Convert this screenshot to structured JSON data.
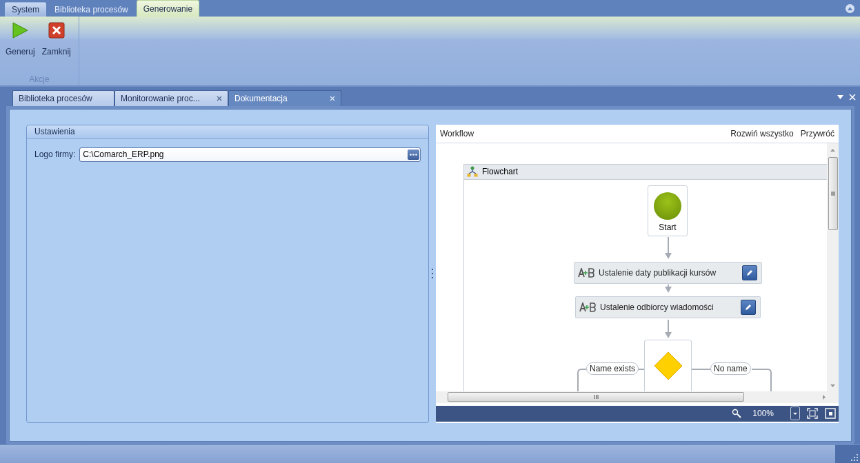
{
  "ribbon_tabs": [
    {
      "label": "System",
      "kind": "app",
      "selected": false
    },
    {
      "label": "Biblioteka procesów",
      "kind": "tab",
      "selected": false
    },
    {
      "label": "Generowanie",
      "kind": "tab",
      "selected": true
    }
  ],
  "ribbon_group": {
    "label": "Akcje",
    "buttons": [
      {
        "label": "Generuj",
        "kind": "play"
      },
      {
        "label": "Zamknij",
        "kind": "close"
      }
    ]
  },
  "document_tabs": [
    {
      "label": "Biblioteka procesów",
      "closable": false,
      "selected": false
    },
    {
      "label": "Monitorowanie proc...",
      "closable": true,
      "selected": false
    },
    {
      "label": "Dokumentacja",
      "closable": true,
      "selected": true
    }
  ],
  "settings": {
    "title": "Ustawienia",
    "field_label": "Logo firmy:",
    "field_value": "C:\\Comarch_ERP.png"
  },
  "designer": {
    "title": "Workflow",
    "actions": [
      "Rozwiń wszystko",
      "Przywróć"
    ],
    "flowchart_title": "Flowchart",
    "nodes": [
      {
        "kind": "start",
        "label": "Start"
      },
      {
        "kind": "assign",
        "label": "Ustalenie daty publikacji kursów"
      },
      {
        "kind": "assign",
        "label": "Ustalenie odbiorcy wiadomości"
      },
      {
        "kind": "decision",
        "true_label": "Name exists",
        "false_label": "No name"
      }
    ],
    "zoom": "100%"
  }
}
